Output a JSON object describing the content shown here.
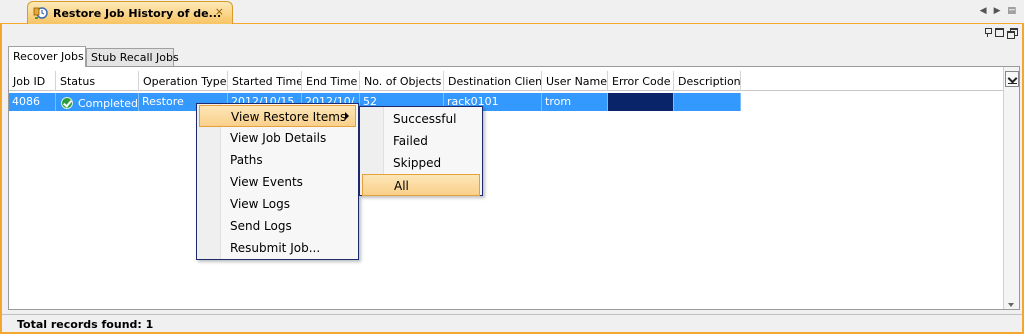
{
  "window": {
    "tab_title": "Restore Job History of de...",
    "tab_close": "×",
    "nav_left": "◀",
    "nav_right": "▶",
    "nav_menu": "▤"
  },
  "tabs": [
    {
      "label": "Recover Jobs",
      "active": true
    },
    {
      "label": "Stub Recall Jobs",
      "active": false
    }
  ],
  "table": {
    "columns": [
      "Job ID",
      "Status",
      "Operation Type",
      "Started Time",
      "End Time",
      "No. of Objects",
      "Destination Client",
      "User Name",
      "Error Code",
      "Description"
    ],
    "rows": [
      {
        "job_id": "4086",
        "status": "Completed",
        "operation_type": "Restore",
        "started_time": "2012/10/15",
        "end_time": "2012/10/",
        "objects": "52",
        "destination_client": "rack0101",
        "user_name": "trom",
        "error_code": "",
        "description": ""
      }
    ]
  },
  "context_menu": {
    "items": [
      "View Restore Items",
      "View Job Details",
      "Paths",
      "View Events",
      "View Logs",
      "Send Logs",
      "Resubmit Job..."
    ],
    "highlighted": "View Restore Items"
  },
  "submenu": {
    "items": [
      "Successful",
      "Failed",
      "Skipped",
      "All"
    ],
    "highlighted": "All"
  },
  "footer": {
    "total_text": "Total records found: 1"
  },
  "colors": {
    "selection": "#3399ff",
    "tab_orange": "#f3a72e",
    "menu_highlight": "#f9d08a"
  }
}
